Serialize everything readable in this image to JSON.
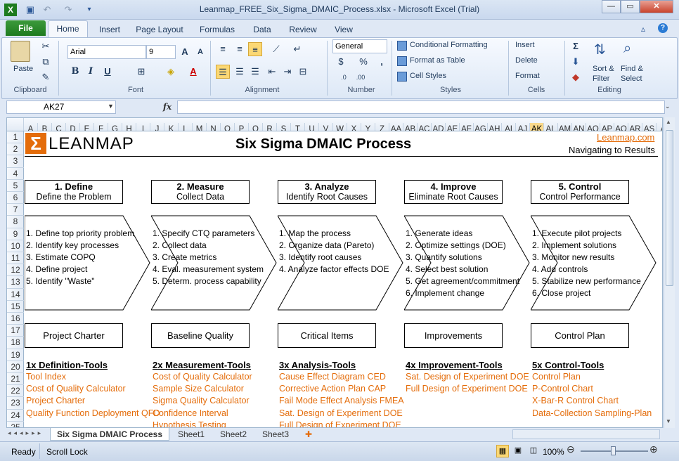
{
  "window": {
    "title": "Leanmap_FREE_Six_Sigma_DMAIC_Process.xlsx - Microsoft Excel (Trial)"
  },
  "ribbon_tabs": [
    "File",
    "Home",
    "Insert",
    "Page Layout",
    "Formulas",
    "Data",
    "Review",
    "View"
  ],
  "clipboard": {
    "paste": "Paste",
    "label": "Clipboard"
  },
  "font": {
    "name": "Arial",
    "size": "9",
    "label": "Font"
  },
  "alignment": {
    "label": "Alignment"
  },
  "number": {
    "format": "General",
    "label": "Number"
  },
  "styles": {
    "conditional": "Conditional Formatting",
    "table": "Format as Table",
    "cell": "Cell Styles",
    "label": "Styles"
  },
  "cells": {
    "insert": "Insert",
    "delete": "Delete",
    "format": "Format",
    "label": "Cells"
  },
  "editing": {
    "sort": "Sort &",
    "filter": "Filter",
    "find": "Find &",
    "select": "Select",
    "label": "Editing"
  },
  "formula_bar": {
    "name_box": "AK27",
    "fx": "fx",
    "value": ""
  },
  "columns": [
    "A",
    "B",
    "C",
    "D",
    "E",
    "F",
    "G",
    "H",
    "I",
    "J",
    "K",
    "L",
    "M",
    "N",
    "O",
    "P",
    "Q",
    "R",
    "S",
    "T",
    "U",
    "V",
    "W",
    "X",
    "Y",
    "Z",
    "AA",
    "AB",
    "AC",
    "AD",
    "AE",
    "AF",
    "AG",
    "AH",
    "AI",
    "AJ",
    "AK",
    "AL",
    "AM",
    "AN",
    "AO",
    "AP",
    "AQ",
    "AR",
    "AS",
    "A"
  ],
  "rows": [
    "1",
    "2",
    "3",
    "4",
    "5",
    "6",
    "7",
    "8",
    "9",
    "10",
    "11",
    "12",
    "13",
    "14",
    "15",
    "16",
    "17",
    "18",
    "19",
    "20",
    "21",
    "22",
    "23",
    "24",
    "25"
  ],
  "sheet": {
    "logo": "LEANMAP",
    "title": "Six Sigma DMAIC Process",
    "link": "Leanmap.com",
    "tagline": "Navigating to Results",
    "steps": [
      {
        "title": "1. Define",
        "sub": "Define the Problem",
        "items": [
          "1. Define top priority problem",
          "2. Identify key processes",
          "3. Estimate COPQ",
          "4. Define project",
          "5. Identify \"Waste\""
        ],
        "output": "Project Charter",
        "tools_title": "1x Definition-Tools",
        "tools": [
          "Tool Index",
          "Cost of Quality Calculator",
          "Project Charter",
          "Quality Function Deployment QFD"
        ]
      },
      {
        "title": "2. Measure",
        "sub": "Collect Data",
        "items": [
          "1. Specify CTQ parameters",
          "2. Collect data",
          "3. Create metrics",
          "4. Eval. measurement system",
          "5. Determ. process capability"
        ],
        "output": "Baseline Quality",
        "tools_title": "2x Measurement-Tools",
        "tools": [
          "Cost of Quality Calculator",
          "Sample Size Calculator",
          "Sigma Quality Calculator",
          "Confidence Interval",
          "Hypothesis Testing"
        ]
      },
      {
        "title": "3. Analyze",
        "sub": "Identify Root Causes",
        "items": [
          "1. Map the process",
          "2. Organize data (Pareto)",
          "3. Identify root causes",
          "4. Analyze factor effects DOE"
        ],
        "output": "Critical Items",
        "tools_title": "3x Analysis-Tools",
        "tools": [
          "Cause Effect Diagram CED",
          "Corrective Action Plan CAP",
          "Fail Mode Effect Analysis FMEA",
          "Sat. Design of Experiment DOE",
          "Full Design of Experiment DOE"
        ]
      },
      {
        "title": "4. Improve",
        "sub": "Eliminate Root Causes",
        "items": [
          "1. Generate ideas",
          "2. Optimize settings (DOE)",
          "3. Quantify solutions",
          "4. Select best solution",
          "5. Get agreement/commitment",
          "6. Implement change"
        ],
        "output": "Improvements",
        "tools_title": "4x Improvement-Tools",
        "tools": [
          "Sat. Design of Experiment DOE",
          "Full Design of Experiment DOE"
        ]
      },
      {
        "title": "5. Control",
        "sub": "Control Performance",
        "items": [
          "1. Execute pilot projects",
          "2. Implement solutions",
          "3. Monitor new results",
          "4. Add controls",
          "5. Stabilize new performance",
          "6. Close project"
        ],
        "output": "Control Plan",
        "tools_title": "5x Control-Tools",
        "tools": [
          "Control Plan",
          "P-Control Chart",
          "X-Bar-R Control Chart",
          "Data-Collection Sampling-Plan"
        ]
      }
    ]
  },
  "sheet_tabs": [
    "Six Sigma DMAIC Process",
    "Sheet1",
    "Sheet2",
    "Sheet3"
  ],
  "status": {
    "ready": "Ready",
    "scroll_lock": "Scroll Lock",
    "zoom": "100%"
  }
}
